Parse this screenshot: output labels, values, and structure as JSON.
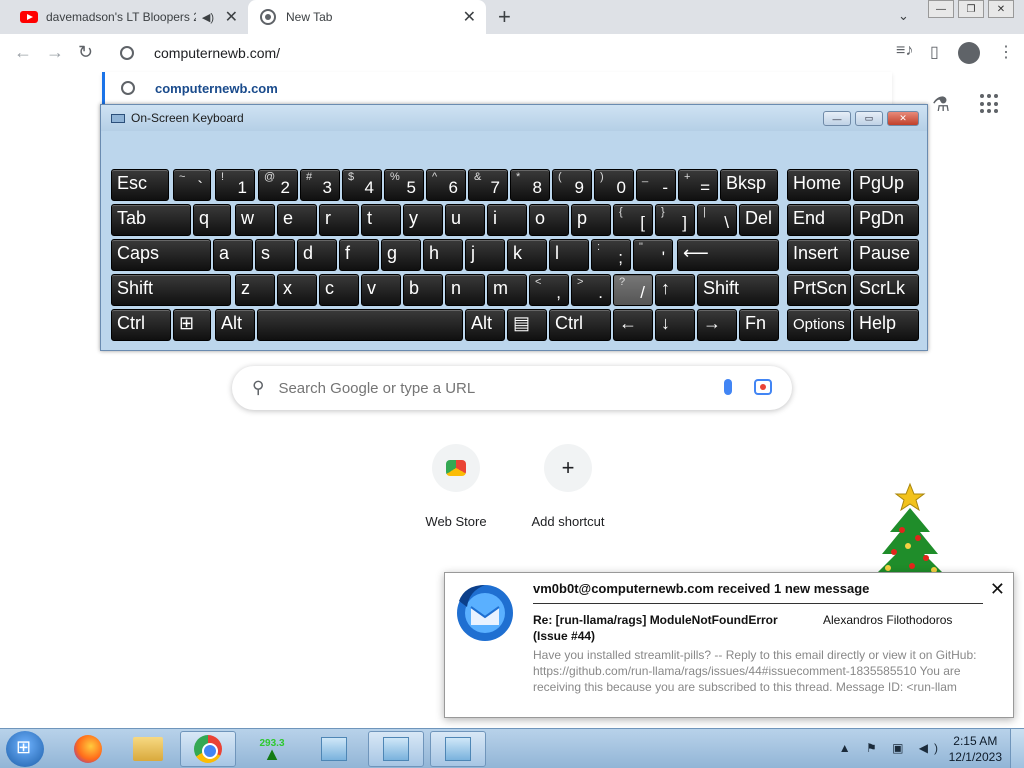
{
  "tabs": [
    {
      "title": "davemadson's LT Bloopers 2",
      "close": "✕",
      "speaker": "◀)"
    },
    {
      "title": "New Tab",
      "close": "✕"
    }
  ],
  "new_tab_symbol": "+",
  "tab_search_symbol": "⌄",
  "window_controls": [
    "—",
    "❐",
    "✕"
  ],
  "nav": {
    "back": "←",
    "forward": "→",
    "reload": "↻"
  },
  "omnibox": {
    "value": "computernewb.com/"
  },
  "suggestion": {
    "text": "computernewb.com"
  },
  "toolbar_right": {
    "media": "≡♪",
    "side_panel": "▯",
    "menu": "⋮"
  },
  "labs_icon": "⚗",
  "osk": {
    "title": "On-Screen Keyboard",
    "buttons": [
      "—",
      "▭",
      "✕"
    ],
    "keys": [
      {
        "l": "Esc"
      },
      {
        "s": "~",
        "c": "`"
      },
      {
        "s": "!",
        "c": "1"
      },
      {
        "s": "@",
        "c": "2"
      },
      {
        "s": "#",
        "c": "3"
      },
      {
        "s": "$",
        "c": "4"
      },
      {
        "s": "%",
        "c": "5"
      },
      {
        "s": "^",
        "c": "6"
      },
      {
        "s": "&",
        "c": "7"
      },
      {
        "s": "*",
        "c": "8"
      },
      {
        "s": "(",
        "c": "9"
      },
      {
        "s": ")",
        "c": "0"
      },
      {
        "s": "_",
        "c": "-"
      },
      {
        "s": "+",
        "c": "="
      },
      {
        "l": "Bksp"
      },
      {
        "l": "Home"
      },
      {
        "l": "PgUp"
      },
      {
        "l": "Tab"
      },
      {
        "l": "q"
      },
      {
        "l": "w"
      },
      {
        "l": "e"
      },
      {
        "l": "r"
      },
      {
        "l": "t"
      },
      {
        "l": "y"
      },
      {
        "l": "u"
      },
      {
        "l": "i"
      },
      {
        "l": "o"
      },
      {
        "l": "p"
      },
      {
        "s": "{",
        "c": "["
      },
      {
        "s": "}",
        "c": "]"
      },
      {
        "s": "|",
        "c": "\\"
      },
      {
        "l": "Del"
      },
      {
        "l": "End"
      },
      {
        "l": "PgDn"
      },
      {
        "l": "Caps"
      },
      {
        "l": "a"
      },
      {
        "l": "s"
      },
      {
        "l": "d"
      },
      {
        "l": "f"
      },
      {
        "l": "g"
      },
      {
        "l": "h"
      },
      {
        "l": "j"
      },
      {
        "l": "k"
      },
      {
        "l": "l"
      },
      {
        "s": ":",
        "c": ";"
      },
      {
        "s": "\"",
        "c": "'"
      },
      {
        "l": "⟵"
      },
      {
        "l": "Insert"
      },
      {
        "l": "Pause"
      },
      {
        "l": "Shift"
      },
      {
        "l": "z"
      },
      {
        "l": "x"
      },
      {
        "l": "c"
      },
      {
        "l": "v"
      },
      {
        "l": "b"
      },
      {
        "l": "n"
      },
      {
        "l": "m"
      },
      {
        "s": "<",
        "c": ","
      },
      {
        "s": ">",
        "c": "."
      },
      {
        "s": "?",
        "c": "/"
      },
      {
        "l": "↑"
      },
      {
        "l": "Shift"
      },
      {
        "l": "PrtScn"
      },
      {
        "l": "ScrLk"
      },
      {
        "l": "Ctrl"
      },
      {
        "l": "⊞"
      },
      {
        "l": "Alt"
      },
      {
        "l": ""
      },
      {
        "l": "Alt"
      },
      {
        "l": "▤"
      },
      {
        "l": "Ctrl"
      },
      {
        "l": "←"
      },
      {
        "l": "↓"
      },
      {
        "l": "→"
      },
      {
        "l": "Fn"
      },
      {
        "l": "Options"
      },
      {
        "l": "Help"
      }
    ]
  },
  "search": {
    "placeholder": "Search Google or type a URL",
    "icon": "⚲"
  },
  "shortcuts": [
    {
      "name": "Web Store"
    },
    {
      "name": "Add shortcut",
      "symbol": "+"
    }
  ],
  "notification": {
    "headline": "vm0b0t@computernewb.com received 1 new message",
    "subject": "Re: [run-llama/rags] ModuleNotFoundError (Issue #44)",
    "from": "Alexandros Filothodoros",
    "body": "Have you installed streamlit-pills? -- Reply to this email directly or view it on GitHub: https://github.com/run-llama/rags/issues/44#issuecomment-1835585510 You are receiving this because you are subscribed to this thread. Message ID: <run-llam",
    "close": "✕"
  },
  "taskbar": {
    "tree_counter": "293.3",
    "tray_icons": "▲ ⚑ ▣ ◀)",
    "time": "2:15 AM",
    "date": "12/1/2023"
  }
}
